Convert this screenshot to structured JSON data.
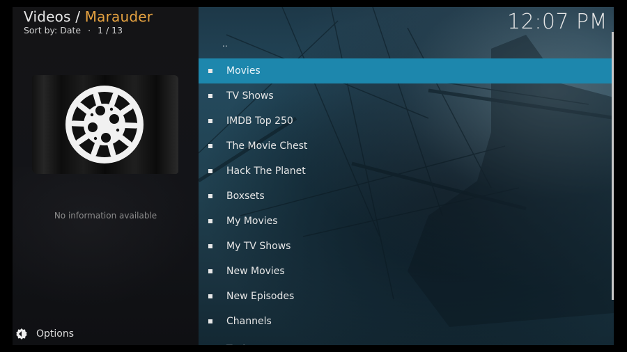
{
  "header": {
    "section": "Videos",
    "separator": " / ",
    "addon": "Marauder",
    "sort_label": "Sort by: Date",
    "sort_dot": "·",
    "position": "1 / 13"
  },
  "clock": {
    "time": "12:07 PM"
  },
  "info_panel": {
    "artwork_icon": "film-reel-icon",
    "no_info_text": "No information available"
  },
  "options": {
    "icon": "options-gear-icon",
    "label": "Options"
  },
  "list": {
    "parent_label": "..",
    "items": [
      {
        "label": "Movies",
        "focused": true
      },
      {
        "label": "TV Shows"
      },
      {
        "label": "IMDB Top 250"
      },
      {
        "label": "The Movie Chest"
      },
      {
        "label": "Hack The Planet"
      },
      {
        "label": "Boxsets"
      },
      {
        "label": "My Movies"
      },
      {
        "label": "My TV Shows"
      },
      {
        "label": "New Movies"
      },
      {
        "label": "New Episodes"
      },
      {
        "label": "Channels"
      },
      {
        "label": "Tools"
      }
    ]
  },
  "colors": {
    "accent": "#e7a341",
    "focus": "#1d87ad"
  }
}
